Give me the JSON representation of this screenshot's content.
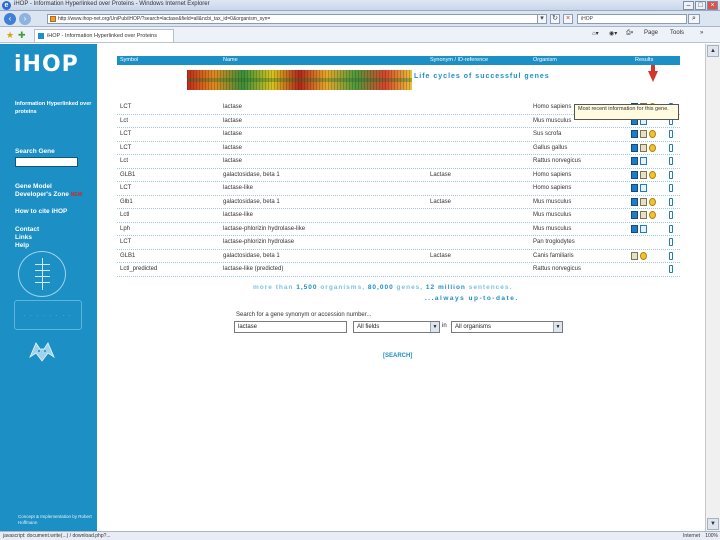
{
  "window": {
    "title": "iHOP - Information Hyperlinked over Proteins - Windows Internet Explorer",
    "url": "http://www.ihop-net.org/UniPub/iHOP/?search=lactase&field=all&ncbi_tax_id=0&organism_syn=",
    "search_value": "iHOP"
  },
  "tab": {
    "label": "iHOP - Information Hyperlinked over Proteins"
  },
  "commands": {
    "page": "Page",
    "tools": "Tools",
    "more": "»"
  },
  "sidebar": {
    "logo": "iHOP",
    "tagline": "Information Hyperlinked over proteins",
    "search_gene": "Search Gene",
    "gene_model": "Gene Model",
    "developers_zone": "Developer's Zone",
    "new_badge": "NEW",
    "how_to_cite": "How to cite iHOP",
    "contact": "Contact",
    "links": "Links",
    "help": "Help",
    "emblem2_text": "· · · · · · · ·",
    "footer": "Concept & Implementation by Robert Hoffmann"
  },
  "table": {
    "headers": [
      "Symbol",
      "Name",
      "Synonym / ID-reference",
      "Organism",
      "Results"
    ],
    "banner_text": "Life cycles of successful genes",
    "tooltip": "Most recent information for this gene.",
    "rows": [
      {
        "symbol": "LCT",
        "name": "lactase",
        "synonym": "",
        "organism": "Homo sapiens"
      },
      {
        "symbol": "Lct",
        "name": "lactase",
        "synonym": "",
        "organism": "Mus musculus"
      },
      {
        "symbol": "LCT",
        "name": "lactase",
        "synonym": "",
        "organism": "Sus scrofa"
      },
      {
        "symbol": "LCT",
        "name": "lactase",
        "synonym": "",
        "organism": "Gallus gallus"
      },
      {
        "symbol": "Lct",
        "name": "lactase",
        "synonym": "",
        "organism": "Rattus norvegicus"
      },
      {
        "symbol": "GLB1",
        "name": "galactosidase, beta 1",
        "synonym": "Lactase",
        "organism": "Homo sapiens"
      },
      {
        "symbol": "LCT",
        "name": "lactase-like",
        "synonym": "",
        "organism": "Homo sapiens"
      },
      {
        "symbol": "Glb1",
        "name": "galactosidase, beta 1",
        "synonym": "Lactase",
        "organism": "Mus musculus"
      },
      {
        "symbol": "Lctl",
        "name": "lactase-like",
        "synonym": "",
        "organism": "Mus musculus"
      },
      {
        "symbol": "Lph",
        "name": "lactase-phlorizin hydrolase-like",
        "synonym": "",
        "organism": "Mus musculus"
      },
      {
        "symbol": "LCT",
        "name": "lactase-phlorizin hydrolase",
        "synonym": "",
        "organism": "Pan troglodytes"
      },
      {
        "symbol": "GLB1",
        "name": "galactosidase, beta 1",
        "synonym": "Lactase",
        "organism": "Canis familiaris"
      },
      {
        "symbol": "Lctl_predicted",
        "name": "lactase-like (predicted)",
        "synonym": "",
        "organism": "Rattus norvegicus"
      }
    ]
  },
  "stats": {
    "prefix": "more than ",
    "organisms": "1,500",
    "organisms_label": " organisms, ",
    "genes": "80,000",
    "genes_label": " genes, ",
    "sentences": "12 million",
    "sentences_label": " sentences.",
    "uptodate": "...always up-to-date."
  },
  "search": {
    "label": "Search for a gene synonym or accession number...",
    "query": "lactase",
    "field": "All fields",
    "in_label": "in",
    "organism": "All organisms",
    "button": "[SEARCH]"
  },
  "statusbar": {
    "left": "javascript: document.write(...) / download.php?...",
    "right": "Internet",
    "zoom": "100%"
  },
  "colors": {
    "brand": "#1c8fc5",
    "arrow": "#d2362a",
    "stats_light": "#7fc1e2"
  }
}
